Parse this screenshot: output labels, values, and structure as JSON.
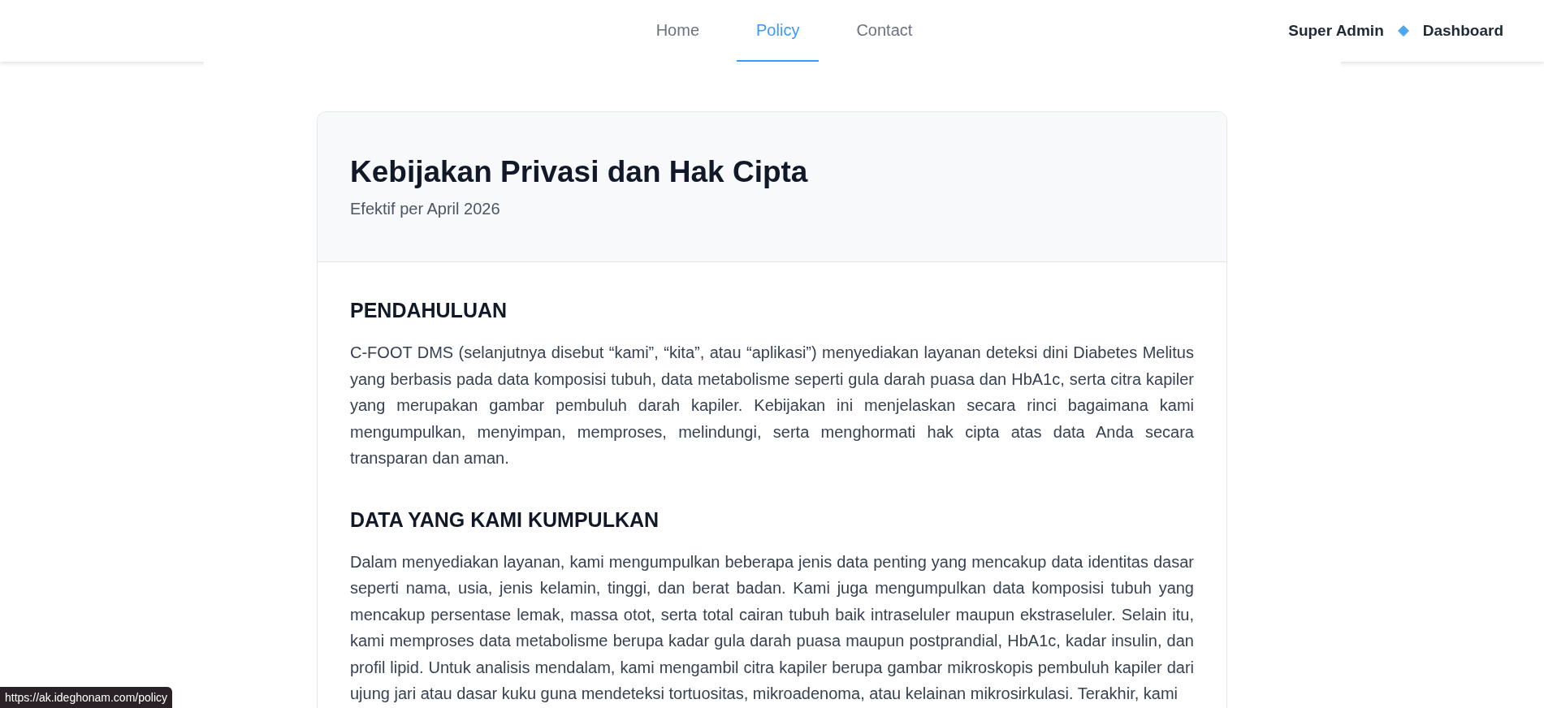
{
  "header": {
    "nav": [
      {
        "label": "Home",
        "selected": false
      },
      {
        "label": "Policy",
        "selected": true
      },
      {
        "label": "Contact",
        "selected": false
      }
    ],
    "user_name": "Super Admin",
    "dashboard_link": "Dashboard"
  },
  "policy": {
    "title": "Kebijakan Privasi dan Hak Cipta",
    "subtitle": "Efektif per April 2026",
    "sections": [
      {
        "heading": "PENDAHULUAN",
        "body": "C-FOOT DMS (selanjutnya disebut “kami”, “kita”, atau “aplikasi”) menyediakan layanan deteksi dini Diabetes Melitus yang berbasis pada data komposisi tubuh, data metabolisme seperti gula darah puasa dan HbA1c, serta citra kapiler yang merupakan gambar pembuluh darah kapiler. Kebijakan ini menjelaskan secara rinci bagaimana kami mengumpulkan, menyimpan, memproses, melindungi, serta menghormati hak cipta atas data Anda secara transparan dan aman."
      },
      {
        "heading": "DATA YANG KAMI KUMPULKAN",
        "body": "Dalam menyediakan layanan, kami mengumpulkan beberapa jenis data penting yang mencakup data identitas dasar seperti nama, usia, jenis kelamin, tinggi, dan berat badan. Kami juga mengumpulkan data komposisi tubuh yang mencakup persentase lemak, massa otot, serta total cairan tubuh baik intraseluler maupun ekstraseluler. Selain itu, kami memproses data metabolisme berupa kadar gula darah puasa maupun postprandial, HbA1c, kadar insulin, dan profil lipid. Untuk analisis mendalam, kami mengambil citra kapiler berupa gambar mikroskopis pembuluh kapiler dari ujung jari atau dasar kuku guna mendeteksi tortuositas, mikroadenoma, atau kelainan mikrosirkulasi. Terakhir, kami"
      }
    ]
  },
  "status_bar": {
    "url": "https://ak.ideghonam.com/policy"
  }
}
